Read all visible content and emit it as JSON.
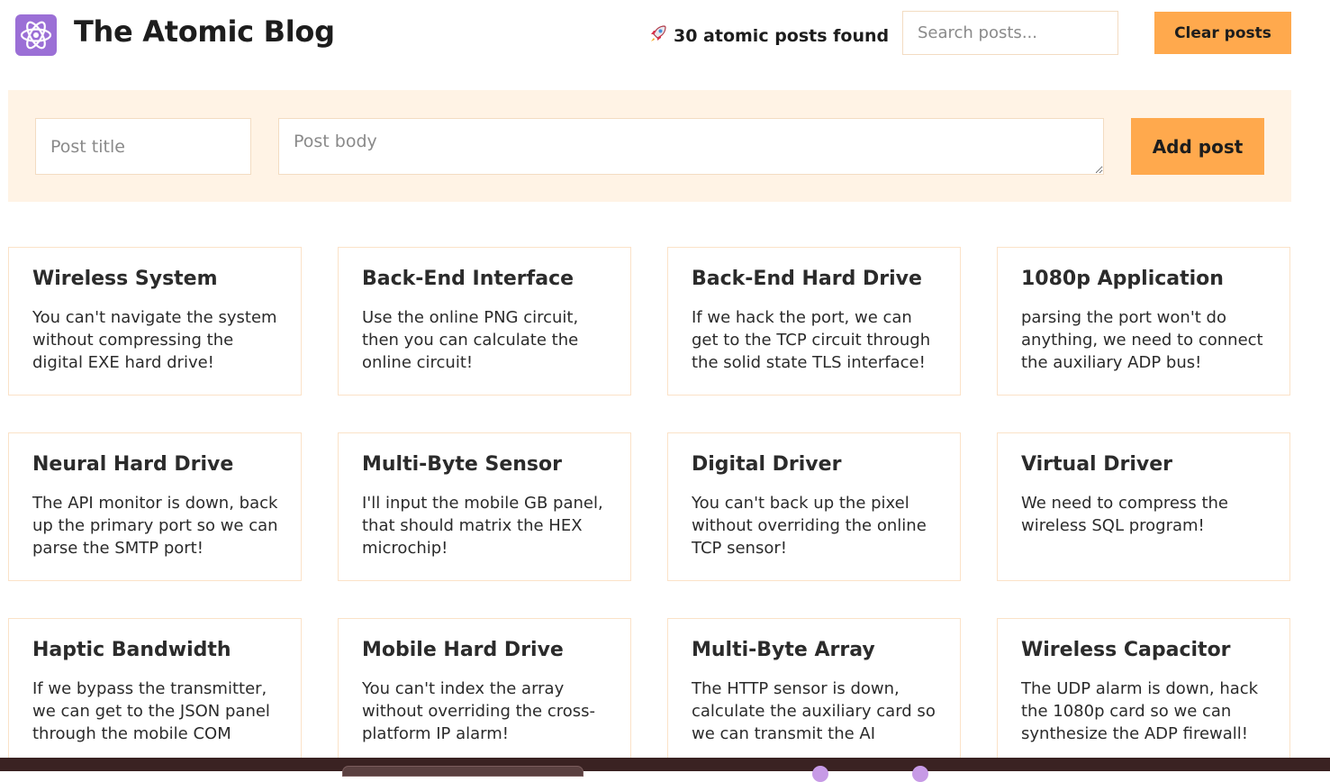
{
  "header": {
    "title": "The Atomic Blog",
    "post_count_label": "30 atomic posts found",
    "search_placeholder": "Search posts...",
    "clear_label": "Clear posts"
  },
  "form": {
    "title_placeholder": "Post title",
    "body_placeholder": "Post body",
    "add_label": "Add post"
  },
  "posts": [
    {
      "title": "Wireless System",
      "body": "You can't navigate the system without compressing the digital EXE hard drive!"
    },
    {
      "title": "Back-End Interface",
      "body": "Use the online PNG circuit, then you can calculate the online circuit!"
    },
    {
      "title": "Back-End Hard Drive",
      "body": "If we hack the port, we can get to the TCP circuit through the solid state TLS interface!"
    },
    {
      "title": "1080p Application",
      "body": "parsing the port won't do anything, we need to connect the auxiliary ADP bus!"
    },
    {
      "title": "Neural Hard Drive",
      "body": "The API monitor is down, back up the primary port so we can parse the SMTP port!"
    },
    {
      "title": "Multi-Byte Sensor",
      "body": "I'll input the mobile GB panel, that should matrix the HEX microchip!"
    },
    {
      "title": "Digital Driver",
      "body": "You can't back up the pixel without overriding the online TCP sensor!"
    },
    {
      "title": "Virtual Driver",
      "body": "We need to compress the wireless SQL program!"
    },
    {
      "title": "Haptic Bandwidth",
      "body": "If we bypass the transmitter, we can get to the JSON panel through the mobile COM"
    },
    {
      "title": "Mobile Hard Drive",
      "body": "You can't index the array without overriding the cross-platform IP alarm!"
    },
    {
      "title": "Multi-Byte Array",
      "body": "The HTTP sensor is down, calculate the auxiliary card so we can transmit the AI"
    },
    {
      "title": "Wireless Capacitor",
      "body": "The UDP alarm is down, hack the 1080p card so we can synthesize the ADP firewall!"
    }
  ],
  "colors": {
    "accent": "#ffa94d",
    "form_background": "#fff3e5",
    "logo": "#9b6fd6",
    "card_border": "#fbe2c8"
  },
  "icons": {
    "logo": "atom-icon",
    "count": "rocket-icon"
  }
}
